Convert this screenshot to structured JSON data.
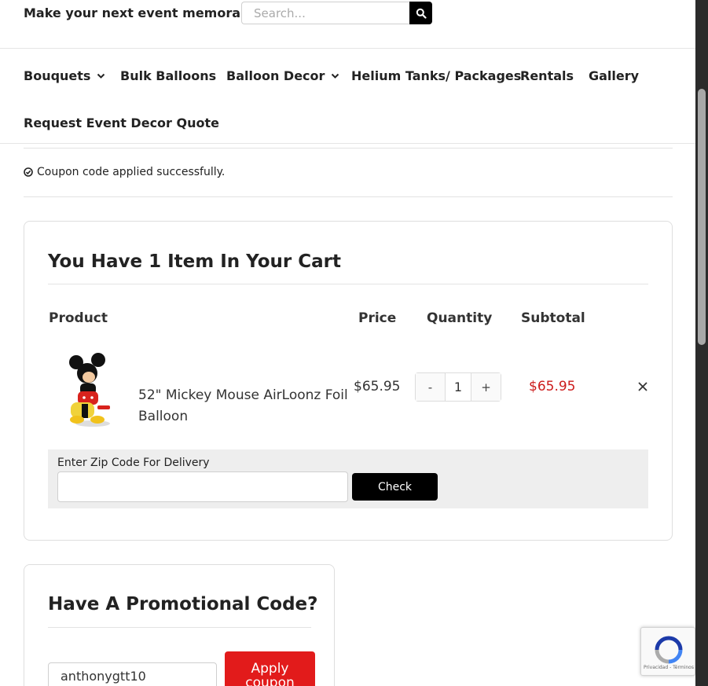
{
  "header": {
    "tagline": "Make your next event memorable!",
    "search_placeholder": "Search...",
    "search_icon": "search-icon"
  },
  "nav": {
    "items": [
      {
        "label": "Bouquets",
        "has_dropdown": true
      },
      {
        "label": "Bulk Balloons",
        "has_dropdown": false
      },
      {
        "label": "Balloon Decor",
        "has_dropdown": true
      },
      {
        "label": "Helium Tanks/ Packages",
        "has_dropdown": false
      },
      {
        "label": "Rentals",
        "has_dropdown": false
      },
      {
        "label": "Gallery",
        "has_dropdown": false
      },
      {
        "label": "Request Event Decor Quote",
        "has_dropdown": false
      }
    ]
  },
  "notice": {
    "text": "Coupon code applied successfully.",
    "icon": "check-circle-icon"
  },
  "cart": {
    "title": "You Have 1 Item In Your Cart",
    "columns": {
      "product": "Product",
      "price": "Price",
      "quantity": "Quantity",
      "subtotal": "Subtotal"
    },
    "items": [
      {
        "name": "52\" Mickey Mouse AirLoonz Foil Balloon",
        "price": "$65.95",
        "quantity": "1",
        "decrement": "-",
        "increment": "+",
        "subtotal": "$65.95"
      }
    ],
    "zip_label": "Enter Zip Code For Delivery",
    "zip_value": "",
    "check_label": "Check"
  },
  "promo": {
    "title": "Have A Promotional Code?",
    "code_value": "anthonygtt10",
    "apply_label": "Apply coupon"
  },
  "recaptcha": {
    "links": "Privacidad - Términos"
  },
  "colors": {
    "subtotal": "#cc1c1c",
    "apply_button": "#e21b1b",
    "check_button": "#000000"
  }
}
